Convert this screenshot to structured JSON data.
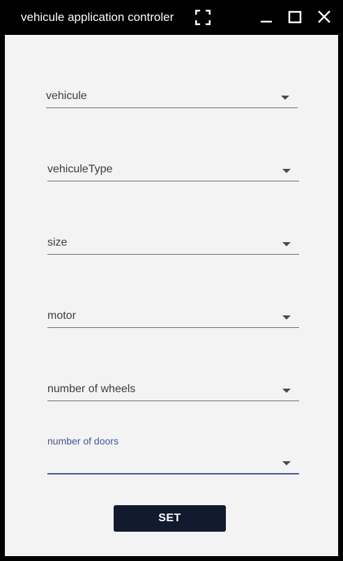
{
  "window": {
    "title": "vehicule application controler"
  },
  "form": {
    "fields": [
      {
        "label": "vehicule"
      },
      {
        "label": "vehiculeType"
      },
      {
        "label": "size"
      },
      {
        "label": "motor"
      },
      {
        "label": "number of wheels"
      },
      {
        "label": "number of doors",
        "value": ""
      }
    ],
    "submit_label": "SET"
  },
  "colors": {
    "accent": "#3f56a6",
    "button_bg": "#121a30",
    "content_bg": "#f3f3f3",
    "titlebar_bg": "#000000"
  },
  "icons": {
    "fullscreen": "fullscreen-icon",
    "minimize": "minimize-icon",
    "maximize": "maximize-icon",
    "close": "close-icon",
    "dropdown": "caret-down-icon"
  }
}
